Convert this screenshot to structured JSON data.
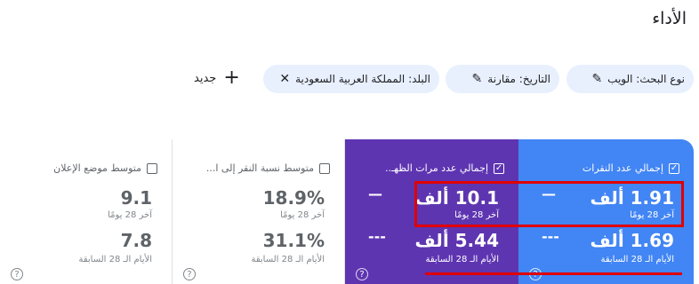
{
  "page": {
    "title": "الأداء"
  },
  "filters": {
    "search_type": "نوع البحث: الويب",
    "date": "التاريخ: مقارنة",
    "country": "البلد: المملكة العربية السعودية",
    "new_label": "جديد"
  },
  "metrics": {
    "clicks": {
      "label": "إجمالي عدد النقرات",
      "value": "1.91 ألف",
      "period": "آخر 28 يومًا",
      "prev_value": "1.69 ألف",
      "prev_period": "الأيام الـ 28 السابقة",
      "dash": "—",
      "prev_dash": "---"
    },
    "impressions": {
      "label": "إجمالي عدد مرات الظهـ..",
      "value": "10.1 ألف",
      "period": "آخر 28 يومًا",
      "prev_value": "5.44 ألف",
      "prev_period": "الأيام الـ 28 السابقة",
      "dash": "—",
      "prev_dash": "---"
    },
    "ctr": {
      "label": "متوسط نسبة النقر إلى ا...",
      "value": "18.9%",
      "period": "آخر 28 يومًا",
      "prev_value": "31.1%",
      "prev_period": "الأيام الـ 28 السابقة"
    },
    "position": {
      "label": "متوسط موضع الإعلان",
      "value": "9.1",
      "period": "آخر 28 يومًا",
      "prev_value": "7.8",
      "prev_period": "الأيام الـ 28 السابقة"
    }
  },
  "icons": {
    "edit": "✎",
    "close": "✕",
    "plus": "+",
    "check": "✓",
    "help": "?"
  },
  "colors": {
    "clicks_card": "#4285f4",
    "impressions_card": "#5e35b1",
    "chip_bg": "#e8f0fe",
    "highlight": "#e00000"
  }
}
